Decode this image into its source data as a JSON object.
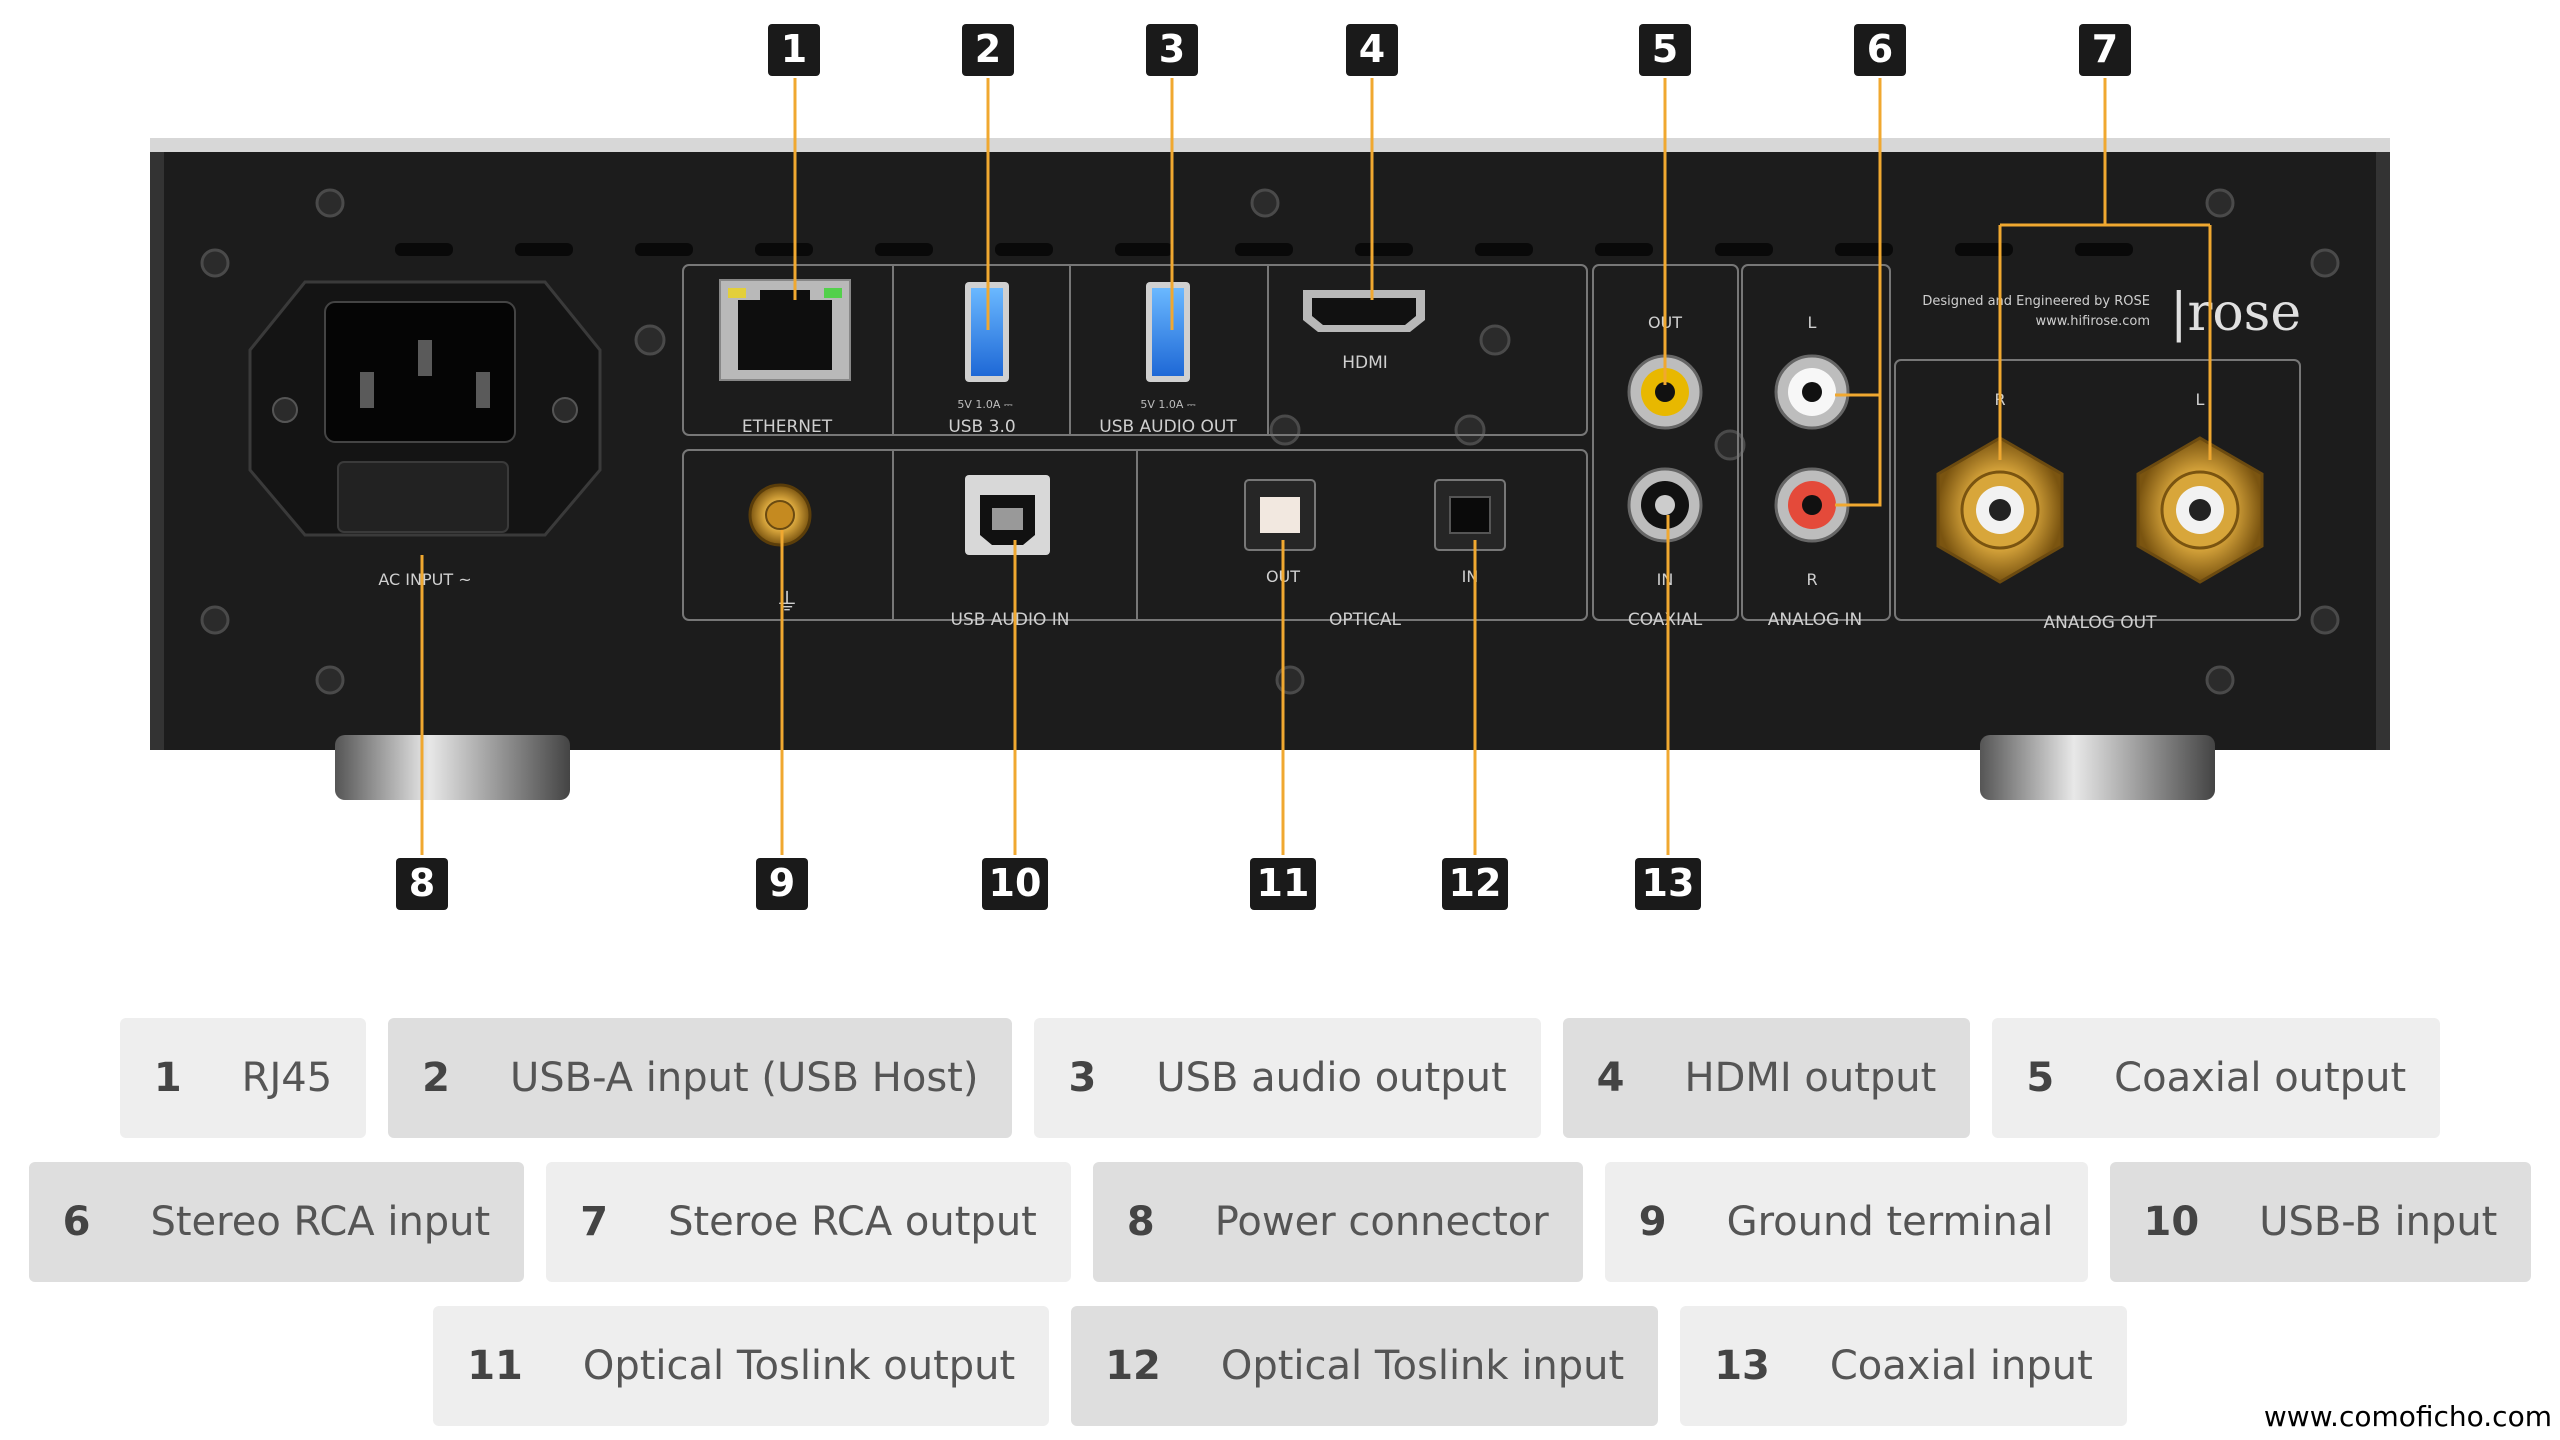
{
  "device": {
    "panel_labels": {
      "ethernet": "ETHERNET",
      "usb30": "USB 3.0",
      "usb_audio_out": "USB AUDIO OUT",
      "hdmi": "HDMI",
      "usb_spec_1": "5V 1.0A ⎓",
      "usb_spec_2": "5V 1.0A ⎓",
      "ac_input": "AC INPUT ~",
      "usb_audio_in": "USB AUDIO IN",
      "optical": "OPTICAL",
      "optical_out": "OUT",
      "optical_in": "IN",
      "coaxial": "COAXIAL",
      "coax_out": "OUT",
      "coax_in": "IN",
      "analog_in": "ANALOG IN",
      "analog_in_l": "L",
      "analog_in_r": "R",
      "analog_out": "ANALOG OUT",
      "analog_out_r": "R",
      "analog_out_l": "L",
      "brand_line1": "Designed and Engineered by ROSE",
      "brand_line2": "www.hifirose.com",
      "brand_logo": "|rose"
    },
    "callouts": [
      "1",
      "2",
      "3",
      "4",
      "5",
      "6",
      "7",
      "8",
      "9",
      "10",
      "11",
      "12",
      "13"
    ]
  },
  "legend": {
    "rows": [
      [
        {
          "num": "1",
          "text": "RJ45",
          "shade": "light"
        },
        {
          "num": "2",
          "text": "USB-A input (USB Host)",
          "shade": "dark"
        },
        {
          "num": "3",
          "text": "USB audio output",
          "shade": "light"
        },
        {
          "num": "4",
          "text": "HDMI output",
          "shade": "dark"
        },
        {
          "num": "5",
          "text": "Coaxial output",
          "shade": "light"
        }
      ],
      [
        {
          "num": "6",
          "text": "Stereo RCA input",
          "shade": "dark"
        },
        {
          "num": "7",
          "text": "Steroe RCA output",
          "shade": "light"
        },
        {
          "num": "8",
          "text": "Power connector",
          "shade": "dark"
        },
        {
          "num": "9",
          "text": "Ground terminal",
          "shade": "light"
        },
        {
          "num": "10",
          "text": "USB-B input",
          "shade": "dark"
        }
      ],
      [
        {
          "num": "11",
          "text": "Optical Toslink output",
          "shade": "light"
        },
        {
          "num": "12",
          "text": "Optical Toslink input",
          "shade": "dark"
        },
        {
          "num": "13",
          "text": "Coaxial input",
          "shade": "light"
        }
      ]
    ]
  },
  "credit": "www.comoficho.com",
  "colors": {
    "leader": "#f0a830",
    "panel": "#1c1c1c",
    "badge": "#1a1a1a",
    "legend_light": "#eeeeee",
    "legend_dark": "#dedede"
  }
}
